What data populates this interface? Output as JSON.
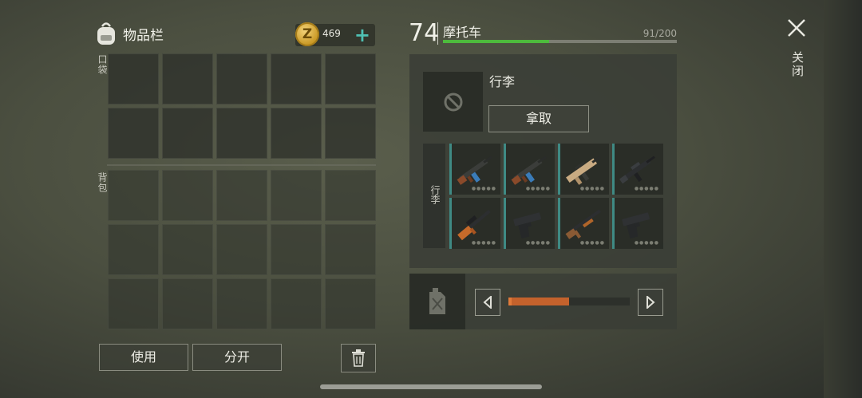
{
  "inventory": {
    "title": "物品栏",
    "coins": "469",
    "coin_symbol": "Z",
    "plus": "+",
    "pocket_label": "口袋",
    "backpack_label": "背包",
    "use_label": "使用",
    "split_label": "分开"
  },
  "vehicle": {
    "level": "74",
    "name": "摩托车",
    "capacity_text": "91/200",
    "capacity_fraction": 0.455
  },
  "luggage": {
    "title": "行李",
    "take_label": "拿取",
    "side_label": "行李",
    "weapons": [
      {
        "icon": "assault-rifle-blue-icon"
      },
      {
        "icon": "assault-rifle-blue-icon"
      },
      {
        "icon": "tan-rifle-icon"
      },
      {
        "icon": "black-rifle-icon"
      },
      {
        "icon": "sniper-rifle-orange-icon"
      },
      {
        "icon": "pistol-icon"
      },
      {
        "icon": "shotgun-icon"
      },
      {
        "icon": "pistol-icon"
      }
    ]
  },
  "fuel": {
    "level_fraction": 0.5
  },
  "close": {
    "label": "关闭"
  },
  "colors": {
    "accent_teal": "#4fc0b3",
    "capacity_green": "#4dba3c",
    "fuel_orange": "#c4622c"
  }
}
